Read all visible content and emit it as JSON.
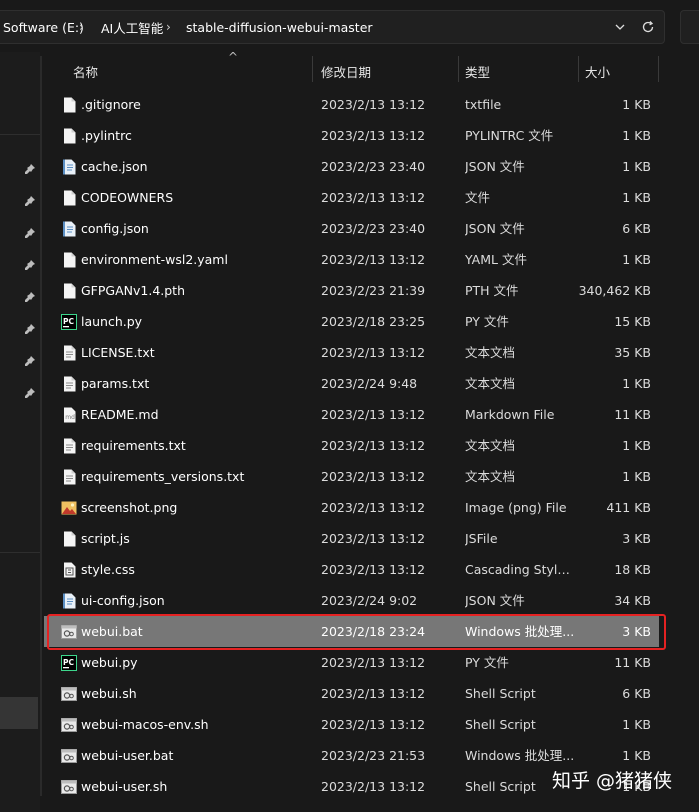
{
  "address_bar": {
    "breadcrumbs": [
      "Software (E:)",
      "AI人工智能",
      "stable-diffusion-webui-master"
    ],
    "separator": "›"
  },
  "columns": {
    "name": "名称",
    "date": "修改日期",
    "type": "类型",
    "size": "大小"
  },
  "files": [
    {
      "name": ".gitignore",
      "date": "2023/2/13 13:12",
      "type": "txtfile",
      "size": "1 KB",
      "icon": "file-icon"
    },
    {
      "name": ".pylintrc",
      "date": "2023/2/13 13:12",
      "type": "PYLINTRC 文件",
      "size": "1 KB",
      "icon": "file-icon"
    },
    {
      "name": "cache.json",
      "date": "2023/2/23 23:40",
      "type": "JSON 文件",
      "size": "1 KB",
      "icon": "json-file-icon"
    },
    {
      "name": "CODEOWNERS",
      "date": "2023/2/13 13:12",
      "type": "文件",
      "size": "1 KB",
      "icon": "file-icon"
    },
    {
      "name": "config.json",
      "date": "2023/2/23 23:40",
      "type": "JSON 文件",
      "size": "6 KB",
      "icon": "json-file-icon"
    },
    {
      "name": "environment-wsl2.yaml",
      "date": "2023/2/13 13:12",
      "type": "YAML 文件",
      "size": "1 KB",
      "icon": "file-icon"
    },
    {
      "name": "GFPGANv1.4.pth",
      "date": "2023/2/23 21:39",
      "type": "PTH 文件",
      "size": "340,462 KB",
      "icon": "file-icon"
    },
    {
      "name": "launch.py",
      "date": "2023/2/18 23:25",
      "type": "PY 文件",
      "size": "15 KB",
      "icon": "pycharm-file-icon"
    },
    {
      "name": "LICENSE.txt",
      "date": "2023/2/13 13:12",
      "type": "文本文档",
      "size": "35 KB",
      "icon": "text-file-icon"
    },
    {
      "name": "params.txt",
      "date": "2023/2/24 9:48",
      "type": "文本文档",
      "size": "1 KB",
      "icon": "text-file-icon"
    },
    {
      "name": "README.md",
      "date": "2023/2/13 13:12",
      "type": "Markdown File",
      "size": "11 KB",
      "icon": "markdown-file-icon"
    },
    {
      "name": "requirements.txt",
      "date": "2023/2/13 13:12",
      "type": "文本文档",
      "size": "1 KB",
      "icon": "text-file-icon"
    },
    {
      "name": "requirements_versions.txt",
      "date": "2023/2/13 13:12",
      "type": "文本文档",
      "size": "1 KB",
      "icon": "text-file-icon"
    },
    {
      "name": "screenshot.png",
      "date": "2023/2/13 13:12",
      "type": "Image (png) File",
      "size": "411 KB",
      "icon": "image-file-icon"
    },
    {
      "name": "script.js",
      "date": "2023/2/13 13:12",
      "type": "JSFile",
      "size": "3 KB",
      "icon": "file-icon"
    },
    {
      "name": "style.css",
      "date": "2023/2/13 13:12",
      "type": "Cascading Style ...",
      "size": "18 KB",
      "icon": "css-file-icon"
    },
    {
      "name": "ui-config.json",
      "date": "2023/2/24 9:02",
      "type": "JSON 文件",
      "size": "34 KB",
      "icon": "json-file-icon"
    },
    {
      "name": "webui.bat",
      "date": "2023/2/18 23:24",
      "type": "Windows 批处理...",
      "size": "3 KB",
      "icon": "script-file-icon",
      "selected": true
    },
    {
      "name": "webui.py",
      "date": "2023/2/13 13:12",
      "type": "PY 文件",
      "size": "11 KB",
      "icon": "pycharm-file-icon"
    },
    {
      "name": "webui.sh",
      "date": "2023/2/13 13:12",
      "type": "Shell Script",
      "size": "6 KB",
      "icon": "script-file-icon"
    },
    {
      "name": "webui-macos-env.sh",
      "date": "2023/2/13 13:12",
      "type": "Shell Script",
      "size": "1 KB",
      "icon": "script-file-icon"
    },
    {
      "name": "webui-user.bat",
      "date": "2023/2/23 21:53",
      "type": "Windows 批处理...",
      "size": "1 KB",
      "icon": "script-file-icon"
    },
    {
      "name": "webui-user.sh",
      "date": "2023/2/13 13:12",
      "type": "Shell Script",
      "size": "1 KB",
      "icon": "script-file-icon"
    }
  ],
  "watermark": "知乎 @猪猪侠",
  "colors": {
    "background": "#191919",
    "selected_row": "#777777",
    "highlight_box": "#e52222"
  }
}
